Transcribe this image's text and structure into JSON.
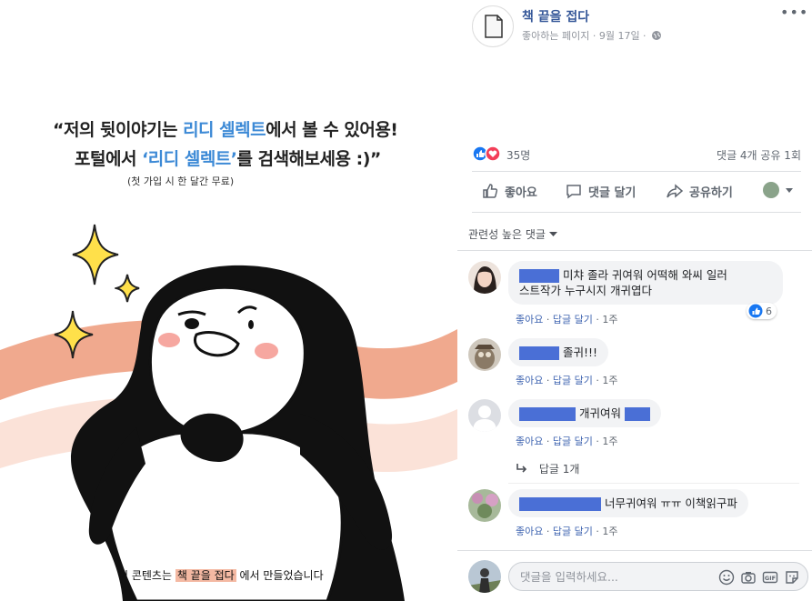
{
  "post_image": {
    "quote_line1_a": "“저의 뒷이야기는 ",
    "quote_line1_hl": "리디 셀렉트",
    "quote_line1_b": "에서 볼 수 있어용!",
    "quote_line2_a": "포털에서 ",
    "quote_line2_hl": "‘리디 셀렉트’",
    "quote_line2_b": "를 검색해보세용 :)”",
    "quote_line3": "(첫 가입 시 한 달간 무료)",
    "caption_a": "이 콘텐츠는 ",
    "caption_hl": "책 끝을 접다",
    "caption_b": " 에서 만들었습니다"
  },
  "header": {
    "page_name": "책 끝을 접다",
    "meta": "좋아하는 페이지 · 9월 17일 ·",
    "more": "•••"
  },
  "stats": {
    "reactions": "35명",
    "comments_shares": "댓글 4개  공유 1회"
  },
  "actions": {
    "like": "좋아요",
    "comment": "댓글 달기",
    "share": "공유하기"
  },
  "filter": {
    "label": "관련성 높은 댓글"
  },
  "comments": [
    {
      "text": " 미챠 졸라 귀여워 어떡해 와씨 일러",
      "text2": "스트작가 누구시지 개귀엽다",
      "meta_like": "좋아요",
      "meta_reply": "답글 달기",
      "meta_time": "1주",
      "likes": "6"
    },
    {
      "text": " 졸귀!!!",
      "meta_like": "좋아요",
      "meta_reply": "답글 달기",
      "meta_time": "1주"
    },
    {
      "text": " 개귀여워 ",
      "meta_like": "좋아요",
      "meta_reply": "답글 달기",
      "meta_time": "1주",
      "replies": "답글 1개"
    },
    {
      "text": " 너무귀여워 ㅠㅠ 이책읽구파",
      "meta_like": "좋아요",
      "meta_reply": "답글 달기",
      "meta_time": "1주"
    }
  ],
  "composer": {
    "placeholder": "댓글을 입력하세요..."
  },
  "colors": {
    "link": "#365899",
    "accent": "#4267b2",
    "highlight": "#3d8ad6",
    "stripe": "#f0a98e"
  }
}
